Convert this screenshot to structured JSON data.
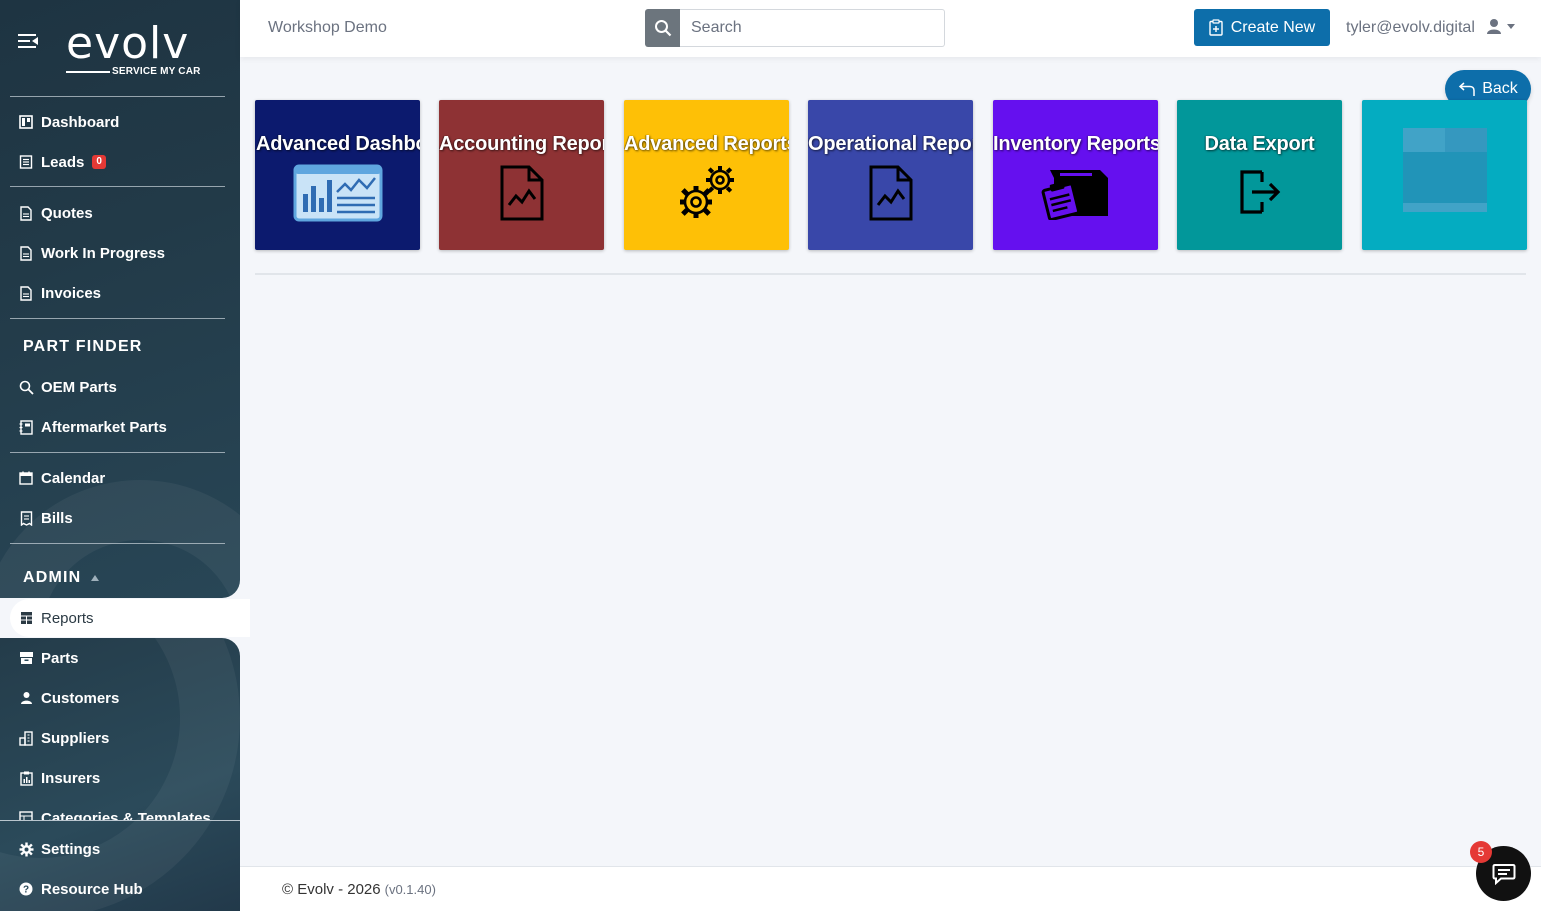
{
  "app": {
    "logo_word": "evolv",
    "logo_sub": "SERVICE MY CAR"
  },
  "sidebar": {
    "items_top": [
      {
        "label": "Dashboard",
        "icon": "dashboard-icon"
      },
      {
        "label": "Leads",
        "icon": "leads-icon",
        "badge": "0"
      }
    ],
    "items_sales": [
      {
        "label": "Quotes",
        "icon": "document-icon"
      },
      {
        "label": "Work In Progress",
        "icon": "document-icon"
      },
      {
        "label": "Invoices",
        "icon": "document-icon"
      }
    ],
    "part_finder_title": "PART FINDER",
    "items_parts": [
      {
        "label": "OEM Parts",
        "icon": "search-icon"
      },
      {
        "label": "Aftermarket Parts",
        "icon": "catalog-icon"
      }
    ],
    "items_misc": [
      {
        "label": "Calendar",
        "icon": "calendar-icon"
      },
      {
        "label": "Bills",
        "icon": "bill-icon"
      }
    ],
    "admin_title": "ADMIN",
    "items_admin": [
      {
        "label": "Reports",
        "icon": "table-icon",
        "active": true
      },
      {
        "label": "Parts",
        "icon": "box-icon"
      },
      {
        "label": "Customers",
        "icon": "user-icon"
      },
      {
        "label": "Suppliers",
        "icon": "building-icon"
      },
      {
        "label": "Insurers",
        "icon": "clipboard-icon"
      },
      {
        "label": "Categories & Templates",
        "icon": "template-icon"
      }
    ],
    "items_bottom": [
      {
        "label": "Settings",
        "icon": "gear-icon"
      },
      {
        "label": "Resource Hub",
        "icon": "help-icon"
      }
    ]
  },
  "header": {
    "workspace": "Workshop Demo",
    "search_placeholder": "Search",
    "create_label": "Create New",
    "user_email": "tyler@evolv.digital"
  },
  "back_label": "Back",
  "tiles": [
    {
      "label": "Advanced Dashboard",
      "color": "#0c1a6e",
      "icon": "dashboard-chart-icon"
    },
    {
      "label": "Accounting Reports",
      "color": "#8e3234",
      "icon": "report-file-icon"
    },
    {
      "label": "Advanced Reports",
      "color": "#fec006",
      "icon": "gears-icon"
    },
    {
      "label": "Operational Reports",
      "color": "#3947a9",
      "icon": "report-file-icon"
    },
    {
      "label": "Inventory Reports",
      "color": "#6510ef",
      "icon": "inventory-icon"
    },
    {
      "label": "Data Export",
      "color": "#02979a",
      "icon": "export-icon"
    },
    {
      "label": "",
      "color": "#04acc1",
      "icon": "table-placeholder-icon"
    }
  ],
  "footer": {
    "copyright": "© Evolv - 2026",
    "version": "(v0.1.40)"
  },
  "chat": {
    "badge": "5"
  }
}
